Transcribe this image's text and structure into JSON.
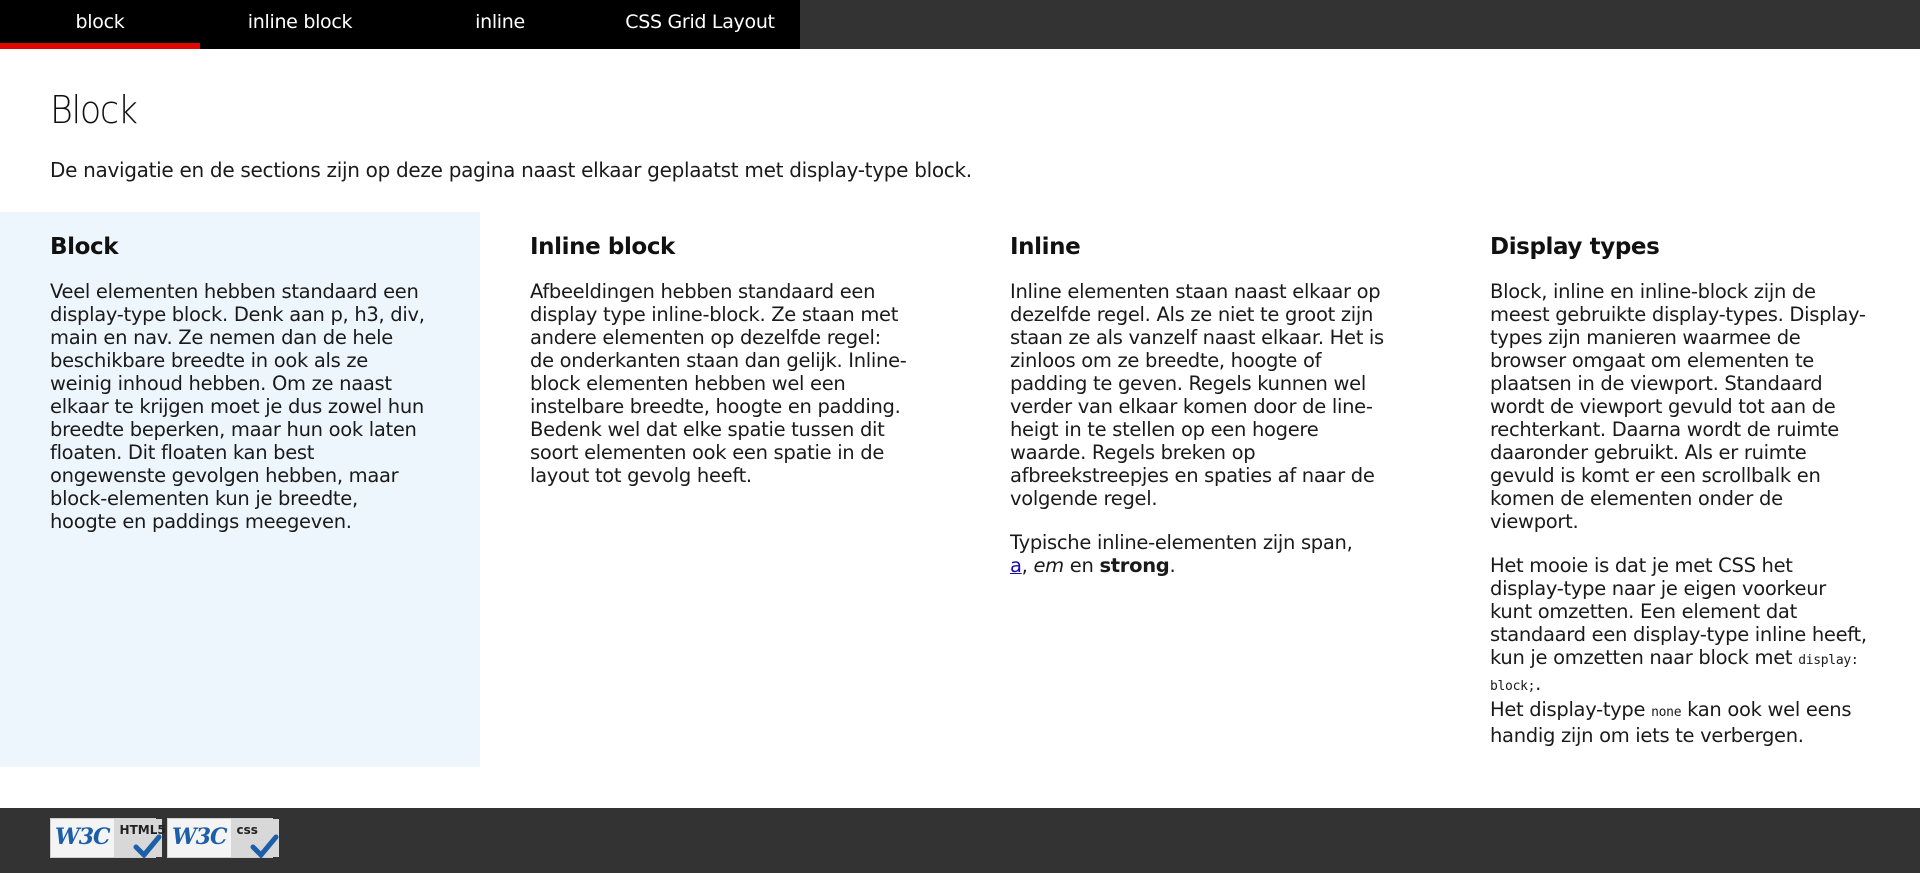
{
  "nav": {
    "tabs": [
      {
        "label": "block",
        "active": true
      },
      {
        "label": "inline block",
        "active": false
      },
      {
        "label": "inline",
        "active": false
      },
      {
        "label": "CSS Grid Layout",
        "active": false
      }
    ]
  },
  "page": {
    "title": "Block",
    "intro": "De navigatie en de sections zijn op deze pagina naast elkaar geplaatst met display-type block."
  },
  "sections": {
    "block": {
      "heading": "Block",
      "paragraph": "Veel elementen hebben standaard een display-type block. Denk aan p, h3, div, main en nav. Ze nemen dan de hele beschikbare breedte in ook als ze weinig inhoud hebben. Om ze naast elkaar te krijgen moet je dus zowel hun breedte beperken, maar hun ook laten floaten. Dit floaten kan best ongewenste gevolgen hebben, maar block-elementen kun je breedte, hoogte en paddings meegeven."
    },
    "inline_block": {
      "heading": "Inline block",
      "paragraph": "Afbeeldingen hebben standaard een display type inline-block. Ze staan met andere elementen op dezelfde regel: de onderkanten staan dan gelijk. Inline-block elementen hebben wel een instelbare breedte, hoogte en padding. Bedenk wel dat elke spatie tussen dit soort elementen ook een spatie in de layout tot gevolg heeft."
    },
    "inline": {
      "heading": "Inline",
      "paragraph": "Inline elementen staan naast elkaar op dezelfde regel. Als ze niet te groot zijn staan ze als vanzelf naast elkaar. Het is zinloos om ze breedte, hoogte of padding te geven. Regels kunnen wel verder van elkaar komen door de line-heigt in te stellen op een hogere waarde. Regels breken op afbreekstreepjes en spaties af naar de volgende regel.",
      "examples_prefix": "Typische inline-elementen zijn span,",
      "example_a": "a",
      "example_sep": ",",
      "example_em": "em",
      "example_and": "en",
      "example_strong": "strong",
      "example_end": "."
    },
    "display_types": {
      "heading": "Display types",
      "paragraph1": "Block, inline en inline-block zijn de meest gebruikte display-types. Display-types zijn manieren waarmee de browser omgaat om elementen te plaatsen in de viewport. Standaard wordt de viewport gevuld tot aan de rechterkant. Daarna wordt de ruimte daaronder gebruikt. Als er ruimte gevuld is komt er een scrollbalk en komen de elementen onder de viewport.",
      "paragraph2_text": "Het mooie is dat je met CSS het display-type naar je eigen voorkeur kunt omzetten. Een element dat standaard een display-type inline heeft, kun je omzetten naar block met",
      "paragraph2_code": "display: block;",
      "paragraph2_end": ".",
      "paragraph2_text2": "Het display-type",
      "paragraph2_code2": "none",
      "paragraph2_text3": "kan ook wel eens handig zijn om iets te verbergen."
    }
  },
  "footer": {
    "badges": [
      {
        "logo": "W3C",
        "label": "HTML5",
        "icon": "checkmark-icon"
      },
      {
        "logo": "W3C",
        "label": "css",
        "icon": "checkmark-icon"
      }
    ],
    "colors": {
      "background": "#333333",
      "accent": "#e10600"
    }
  }
}
